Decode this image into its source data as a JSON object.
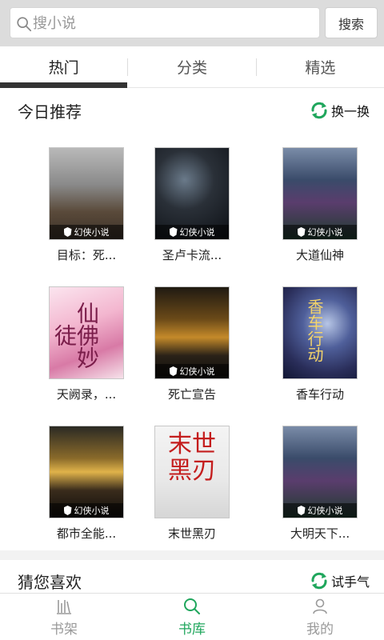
{
  "search": {
    "placeholder": "搜小说",
    "button_label": "搜索"
  },
  "tabs": [
    {
      "label": "热门",
      "active": true
    },
    {
      "label": "分类",
      "active": false
    },
    {
      "label": "精选",
      "active": false
    }
  ],
  "today": {
    "title": "今日推荐",
    "refresh_label": "换一换",
    "books": [
      {
        "title": "目标：死...",
        "cover_brand": "幻侠小说",
        "cover_style": "c1"
      },
      {
        "title": "圣卢卡流...",
        "cover_brand": "幻侠小说",
        "cover_style": "c2"
      },
      {
        "title": "大道仙神",
        "cover_brand": "幻侠小说",
        "cover_style": "c3"
      },
      {
        "title": "天阙录，...",
        "cover_brand": "",
        "cover_style": "c4",
        "cover_text": "仙佛妙徒"
      },
      {
        "title": "死亡宣告",
        "cover_brand": "幻侠小说",
        "cover_style": "c5"
      },
      {
        "title": "香车行动",
        "cover_brand": "",
        "cover_style": "c6",
        "cover_text": "香车行动"
      },
      {
        "title": "都市全能...",
        "cover_brand": "幻侠小说",
        "cover_style": "c7"
      },
      {
        "title": "末世黑刃",
        "cover_brand": "",
        "cover_style": "c8",
        "cover_text": "末世黑刃"
      },
      {
        "title": "大明天下...",
        "cover_brand": "幻侠小说",
        "cover_style": "c9"
      }
    ]
  },
  "guess": {
    "title": "猜您喜欢",
    "refresh_label": "试手气"
  },
  "bottom_nav": [
    {
      "label": "书架",
      "icon": "bookshelf-icon",
      "active": false
    },
    {
      "label": "书库",
      "icon": "search-icon",
      "active": true
    },
    {
      "label": "我的",
      "icon": "user-icon",
      "active": false
    }
  ],
  "colors": {
    "accent": "#1fa65c",
    "topbar": "#dcdcdc"
  }
}
